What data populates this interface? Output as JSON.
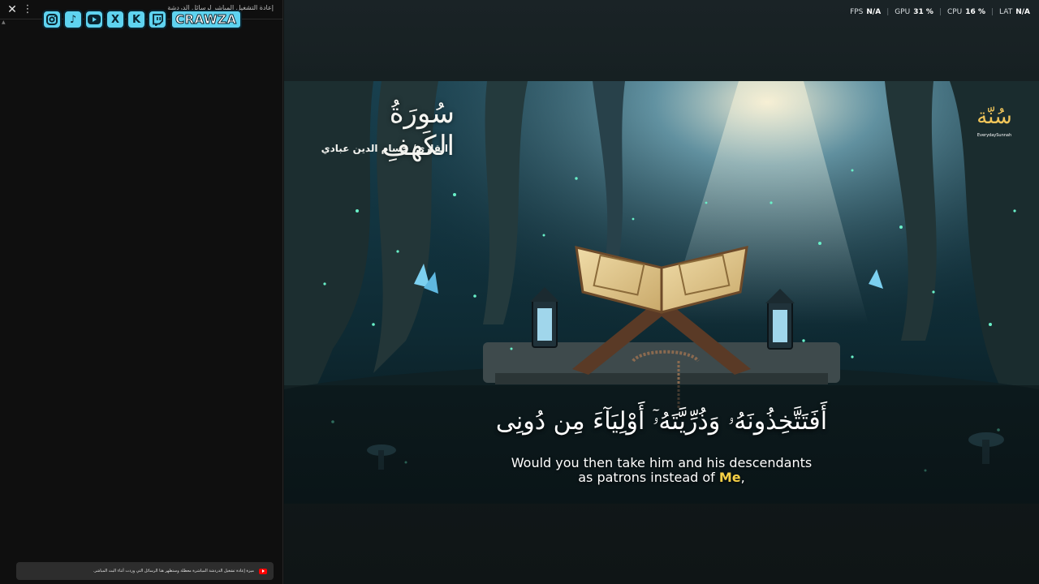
{
  "chat": {
    "close_icon": "close-icon",
    "menu_icon": "more-vert-icon",
    "title": "إعادة التشغيل المباشر لرسائل الدردشة",
    "notice": "ميزة إعادة تشغيل الدردشة المباشرة معطلة وستظهر هنا الرسائل التي وردت أثناء البث المباشر.",
    "notice_icon": "youtube-icon"
  },
  "banner": {
    "icons": [
      "instagram-icon",
      "tiktok-icon",
      "youtube-icon",
      "x-icon",
      "kick-icon",
      "twitch-icon"
    ],
    "brand": "CRAWZA",
    "color": "#5fd3f0"
  },
  "perf": {
    "fps_label": "FPS",
    "fps_value": "N/A",
    "gpu_label": "GPU",
    "gpu_value": "31 %",
    "cpu_label": "CPU",
    "cpu_value": "16 %",
    "lat_label": "LAT",
    "lat_value": "N/A"
  },
  "video": {
    "surah_title": "سُورَةُ الكَهفِ",
    "reciter": "القارئ/ حسام الدين عبادي",
    "logo_mark": "سُنّة",
    "logo_text": "EverydaySunnah",
    "ayah": "أَفَتَتَّخِذُونَهُۥ وَذُرِّيَّتَهُۥٓ أَوْلِيَآءَ مِن دُونِى",
    "translation_line1": "Would you then take him and his descendants",
    "translation_line2_pre": "as patrons instead of ",
    "translation_highlight": "Me",
    "translation_line2_post": ",",
    "highlight_color": "#f7d046"
  }
}
